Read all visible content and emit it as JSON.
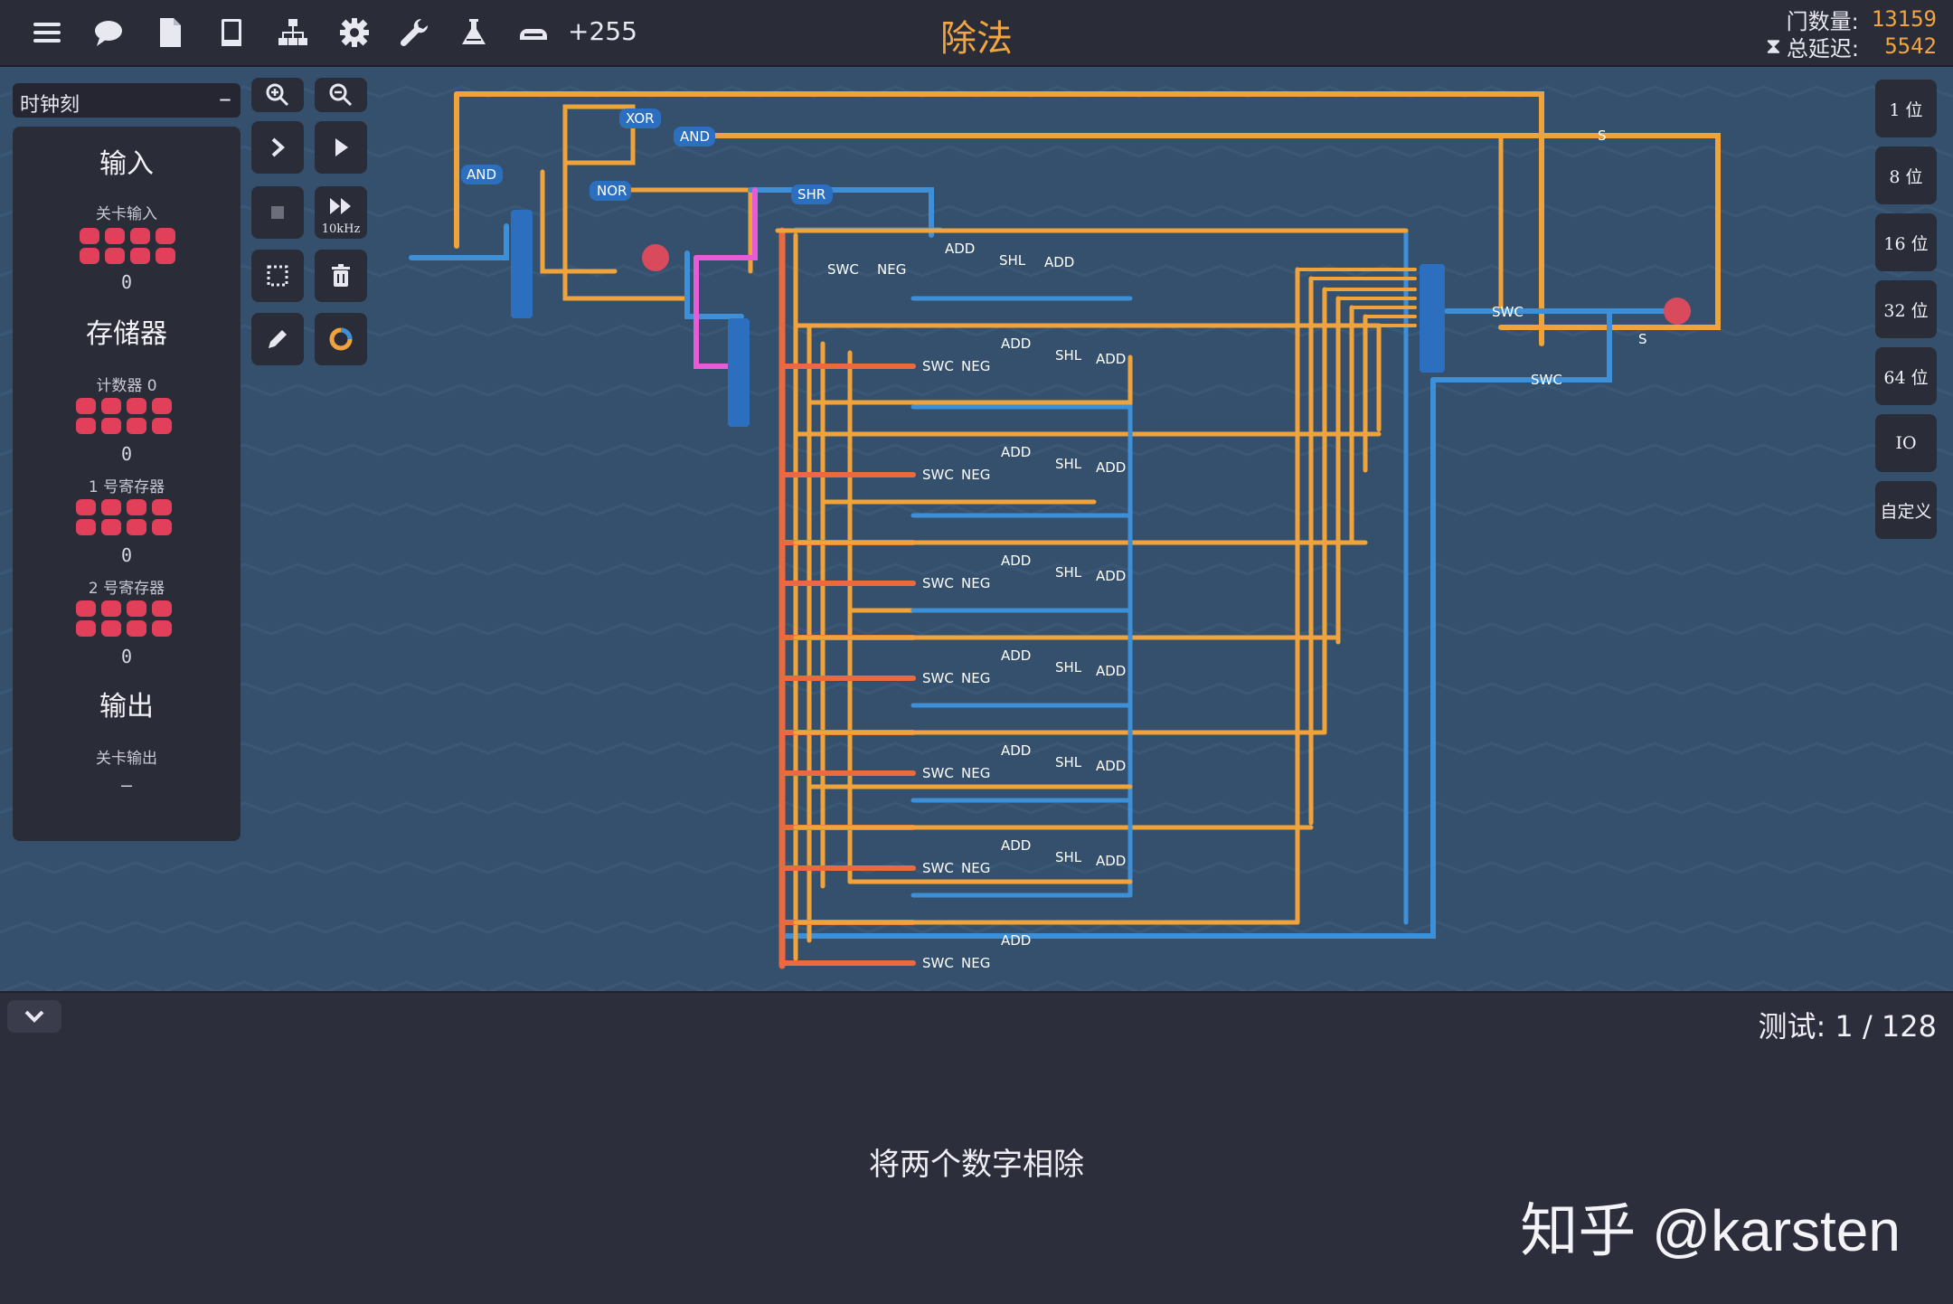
{
  "toolbar": {
    "icons": [
      "menu-icon",
      "chat-icon",
      "document-icon",
      "book-icon",
      "hierarchy-icon",
      "gear-icon",
      "wrench-icon",
      "flask-icon",
      "component-icon"
    ],
    "gate_delta": "+255"
  },
  "level": {
    "title": "除法"
  },
  "stats": {
    "gates_label": "门数量:",
    "gates_value": "13159",
    "delay_label": "总延迟:",
    "delay_value": "5542"
  },
  "left_panel": {
    "clock_label": "时钟刻",
    "clock_minus": "–",
    "inputs_heading": "输入",
    "level_input_label": "关卡输入",
    "level_input_value": "0",
    "memory_heading": "存储器",
    "counter_label": "计数器 0",
    "counter_value": "0",
    "reg1_label": "1 号寄存器",
    "reg1_value": "0",
    "reg2_label": "2 号寄存器",
    "reg2_value": "0",
    "outputs_heading": "输出",
    "level_output_label": "关卡输出",
    "level_output_value": "–"
  },
  "tools": {
    "speed_label": "10kHz"
  },
  "bit_buttons": [
    "1 位",
    "8 位",
    "16 位",
    "32 位",
    "64 位",
    "IO",
    "自定义"
  ],
  "circuit": {
    "top_gates": [
      "XOR",
      "AND",
      "AND",
      "NOR",
      "SHR"
    ],
    "stage_labels": [
      "SWC",
      "NEG",
      "ADD",
      "SHL",
      "ADD"
    ],
    "right_labels": [
      "SWC",
      "SWC",
      "S",
      "S"
    ]
  },
  "colors": {
    "accent": "#f0a540",
    "wire_orange": "#f0a33a",
    "wire_blue": "#3d8fd8",
    "wire_red": "#e86a3e",
    "wire_pink": "#e65bd8",
    "bit_red": "#e23f5a"
  },
  "bottom": {
    "test_label": "测试: 1 / 128",
    "description": "将两个数字相除",
    "watermark": "知乎 @karsten"
  }
}
